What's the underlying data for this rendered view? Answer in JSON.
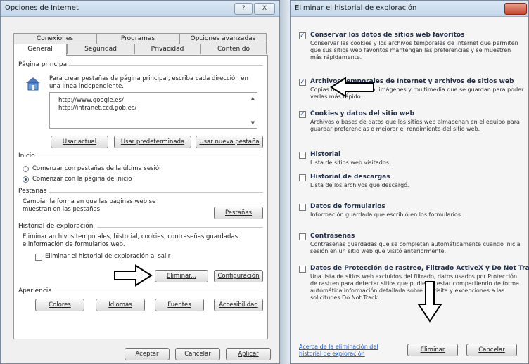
{
  "left_window": {
    "title": "Opciones de Internet",
    "title_buttons": [
      "?",
      "X"
    ],
    "tabs_top": [
      "Conexiones",
      "Programas",
      "Opciones avanzadas"
    ],
    "tabs_bottom": [
      "General",
      "Seguridad",
      "Privacidad",
      "Contenido"
    ],
    "home_section": "Página principal",
    "home_desc": "Para crear pestañas de página principal, escriba cada dirección en una línea independiente.",
    "home_urls": [
      "http://www.google.es/",
      "http://intranet.ccd.gob.es/"
    ],
    "btn_current": "Usar actual",
    "btn_default": "Usar predeterminada",
    "btn_newtab": "Usar nueva pestaña",
    "start_section": "Inicio",
    "radio1": "Comenzar con pestañas de la última sesión",
    "radio2": "Comenzar con la página de inicio",
    "tabs_section": "Pestañas",
    "tabs_desc": "Cambiar la forma en que las páginas web se muestran en las pestañas.",
    "btn_tabs": "Pestañas",
    "history_section": "Historial de exploración",
    "history_desc": "Eliminar archivos temporales, historial, cookies, contraseñas guardadas e información de formularios web.",
    "history_checkbox": "Eliminar el historial de exploración al salir",
    "btn_delete": "Eliminar...",
    "btn_config": "Configuración",
    "appearance_section": "Apariencia",
    "btn_colors": "Colores",
    "btn_languages": "Idiomas",
    "btn_fonts": "Fuentes",
    "btn_access": "Accesibilidad",
    "btn_ok": "Aceptar",
    "btn_cancel": "Cancelar",
    "btn_apply": "Aplicar"
  },
  "right_window": {
    "title": "Eliminar el historial de exploración",
    "items": [
      {
        "checked": true,
        "title": "Conservar los datos de sitios web favoritos",
        "desc": "Conservar las cookies y los archivos temporales de Internet que permiten que sus sitios web favoritos mantengan las preferencias y se muestren más rápidamente."
      },
      {
        "checked": true,
        "title": "Archivos temporales de Internet y archivos de sitios web",
        "desc": "Copias de páginas web, imágenes y multimedia que se guardan para poder verlas más rápido."
      },
      {
        "checked": true,
        "title": "Cookies y datos del sitio web",
        "desc": "Archivos o bases de datos que los sitios web almacenan en el equipo para guardar preferencias o mejorar el rendimiento del sitio web."
      },
      {
        "checked": false,
        "title": "Historial",
        "desc": "Lista de sitios web visitados."
      },
      {
        "checked": false,
        "title": "Historial de descargas",
        "desc": "Lista de los archivos que descargó."
      },
      {
        "checked": false,
        "title": "Datos de formularios",
        "desc": "Información guardada que escribió en los formularios."
      },
      {
        "checked": false,
        "title": "Contraseñas",
        "desc": "Contraseñas guardadas que se completan automáticamente cuando inicia sesión en un sitio web que visitó anteriormente."
      },
      {
        "checked": false,
        "title": "Datos de Protección de rastreo, Filtrado ActiveX y Do Not Track",
        "desc": "Una lista de sitios web excluidos del filtrado, datos usados por Protección de rastreo para detectar sitios que pudieran estar compartiendo de forma automática información detallada sobre su visita y excepciones a las solicitudes Do Not Track."
      }
    ],
    "link": "Acerca de la eliminación del historial de exploración",
    "btn_delete": "Eliminar",
    "btn_cancel": "Cancelar"
  }
}
